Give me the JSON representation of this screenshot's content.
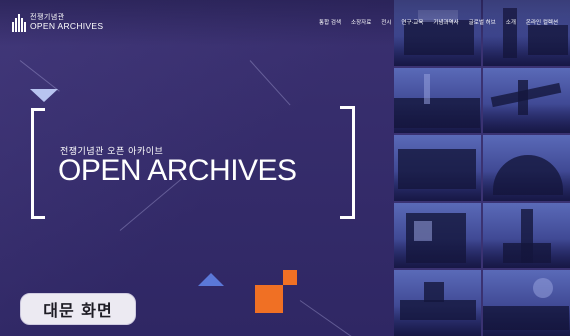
{
  "header": {
    "logo_kr": "전쟁기념관",
    "logo_en": "OPEN ARCHIVES",
    "nav": [
      "통합 검색",
      "소장자료",
      "전시",
      "연구·교육",
      "기념과역사",
      "글로벌 허브",
      "소개",
      "온라인 컬렉션"
    ]
  },
  "hero": {
    "subtitle": "전쟁기념관 오픈 아카이브",
    "title": "OPEN ARCHIVES"
  },
  "caption": "대문 화면",
  "colors": {
    "background": "#372d6b",
    "accent_orange": "#f07024",
    "accent_blue": "#5b78d8",
    "triangle_light": "#b8c4f0"
  }
}
